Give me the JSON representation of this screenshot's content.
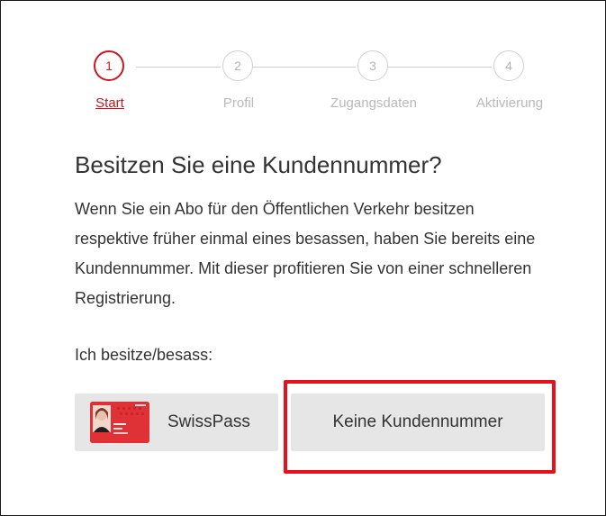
{
  "steps": [
    {
      "number": "1",
      "label": "Start",
      "active": true
    },
    {
      "number": "2",
      "label": "Profil",
      "active": false
    },
    {
      "number": "3",
      "label": "Zugangsdaten",
      "active": false
    },
    {
      "number": "4",
      "label": "Aktivierung",
      "active": false
    }
  ],
  "heading": "Besitzen Sie eine Kundennummer?",
  "description": "Wenn Sie ein Abo für den Öffentlichen Verkehr besitzen respektive früher einmal eines besassen, haben Sie bereits eine Kundennummer. Mit dieser profitieren Sie von einer schnelleren Registrierung.",
  "ownership_label": "Ich besitze/besass:",
  "buttons": {
    "swisspass": {
      "label": "SwissPass",
      "icon": "swisspass-card-icon"
    },
    "none": {
      "label": "Keine Kundennummer"
    }
  },
  "colors": {
    "accent": "#c8171d",
    "highlight": "#e8101a",
    "button_bg": "#e6e6e6",
    "inactive": "#cfcfcf"
  }
}
